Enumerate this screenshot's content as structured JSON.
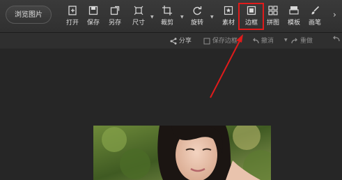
{
  "toolbar": {
    "browse_label": "浏览图片",
    "tools": [
      {
        "name": "open",
        "label": "打开",
        "icon": "open-icon"
      },
      {
        "name": "save",
        "label": "保存",
        "icon": "save-icon"
      },
      {
        "name": "save-as",
        "label": "另存",
        "icon": "save-as-icon"
      },
      {
        "name": "size",
        "label": "尺寸",
        "icon": "resize-icon"
      },
      {
        "name": "crop",
        "label": "裁剪",
        "icon": "crop-icon"
      },
      {
        "name": "rotate",
        "label": "旋转",
        "icon": "rotate-icon"
      },
      {
        "name": "material",
        "label": "素材",
        "icon": "star-icon"
      },
      {
        "name": "border",
        "label": "边框",
        "icon": "border-icon"
      },
      {
        "name": "collage",
        "label": "拼图",
        "icon": "grid-icon"
      },
      {
        "name": "template",
        "label": "模板",
        "icon": "template-icon"
      },
      {
        "name": "brush",
        "label": "画笔",
        "icon": "brush-icon"
      }
    ]
  },
  "subbar": {
    "share": "分享",
    "save_border": "保存边框",
    "undo": "撤消",
    "redo": "重做"
  },
  "annotation": {
    "color": "#e01b1b",
    "highlighted_tool": "边框"
  }
}
